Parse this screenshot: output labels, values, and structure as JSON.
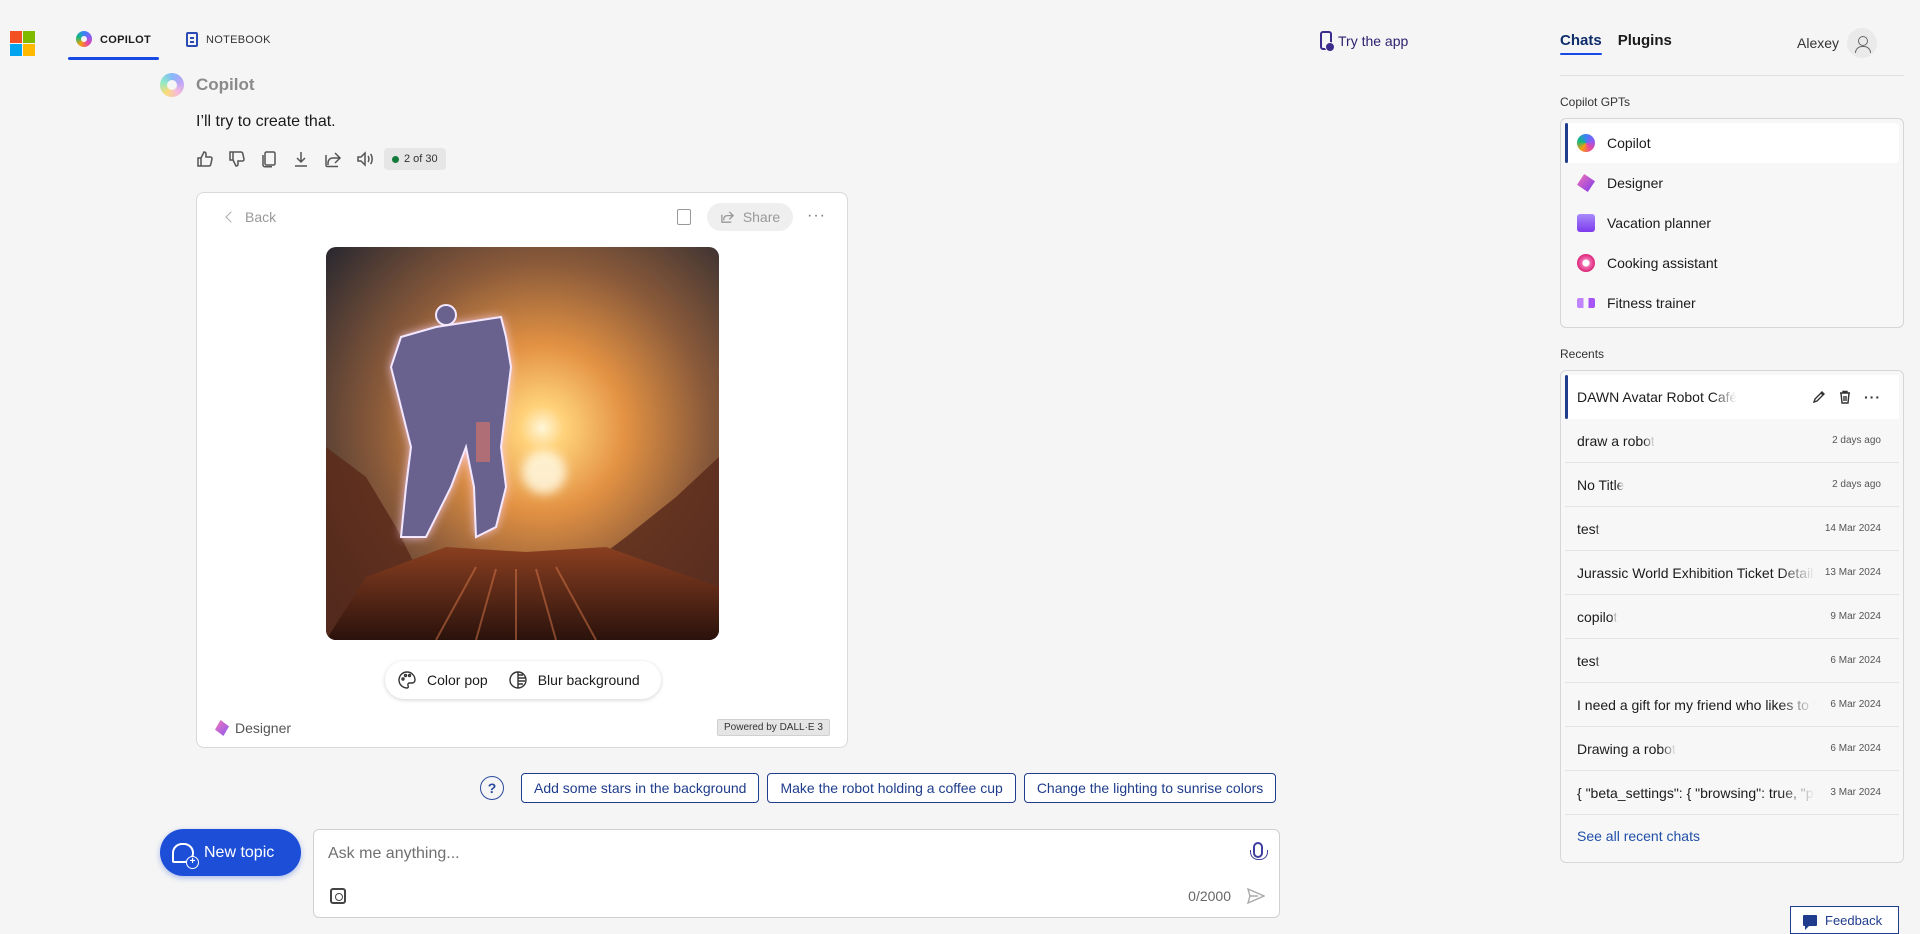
{
  "header": {
    "tabs": [
      {
        "label": "COPILOT",
        "icon": "copilot-logo-icon",
        "active": true
      },
      {
        "label": "NOTEBOOK",
        "icon": "notebook-icon",
        "active": false
      }
    ],
    "try_app_label": "Try the app"
  },
  "message": {
    "author": "Copilot",
    "text": "I’ll try to create that.",
    "page_indicator": "2 of 30",
    "action_icons": [
      "thumbs-up-icon",
      "thumbs-down-icon",
      "copy-icon",
      "download-icon",
      "share-icon",
      "read-aloud-icon"
    ]
  },
  "image_card": {
    "back_label": "Back",
    "share_label": "Share",
    "more_label": "···",
    "tools": [
      {
        "label": "Color pop",
        "icon": "palette-icon"
      },
      {
        "label": "Blur background",
        "icon": "blur-icon"
      }
    ],
    "brand_label": "Designer",
    "powered_by": "Powered by DALL·E 3"
  },
  "suggestions": [
    "Add some stars in the background",
    "Make the robot holding a coffee cup",
    "Change the lighting to sunrise colors"
  ],
  "composer": {
    "new_topic_label": "New topic",
    "placeholder": "Ask me anything...",
    "value": "",
    "counter": "0/2000"
  },
  "panel": {
    "tabs": [
      {
        "label": "Chats",
        "active": true
      },
      {
        "label": "Plugins",
        "active": false
      }
    ],
    "user_name": "Alexey",
    "gpts_label": "Copilot GPTs",
    "gpts": [
      {
        "label": "Copilot",
        "icon": "copilot",
        "active": true
      },
      {
        "label": "Designer",
        "icon": "designer",
        "active": false
      },
      {
        "label": "Vacation planner",
        "icon": "vacation",
        "active": false
      },
      {
        "label": "Cooking assistant",
        "icon": "cooking",
        "active": false
      },
      {
        "label": "Fitness trainer",
        "icon": "fitness",
        "active": false
      }
    ],
    "recents_label": "Recents",
    "recents": [
      {
        "title": "DAWN Avatar Robot Café",
        "date": "",
        "active": true
      },
      {
        "title": "draw a robot",
        "date": "2 days ago"
      },
      {
        "title": "No Title",
        "date": "2 days ago"
      },
      {
        "title": "test",
        "date": "14 Mar 2024"
      },
      {
        "title": "Jurassic World Exhibition Ticket Details",
        "date": "13 Mar 2024"
      },
      {
        "title": "copilot",
        "date": "9 Mar 2024"
      },
      {
        "title": "test",
        "date": "6 Mar 2024"
      },
      {
        "title": "I need a gift for my friend who likes to travel",
        "date": "6 Mar 2024"
      },
      {
        "title": "Drawing a robot",
        "date": "6 Mar 2024"
      },
      {
        "title": "{ \"beta_settings\": { \"browsing\": true, \"plugins\": true",
        "date": "3 Mar 2024"
      }
    ],
    "see_all_label": "See all recent chats"
  },
  "feedback_label": "Feedback"
}
